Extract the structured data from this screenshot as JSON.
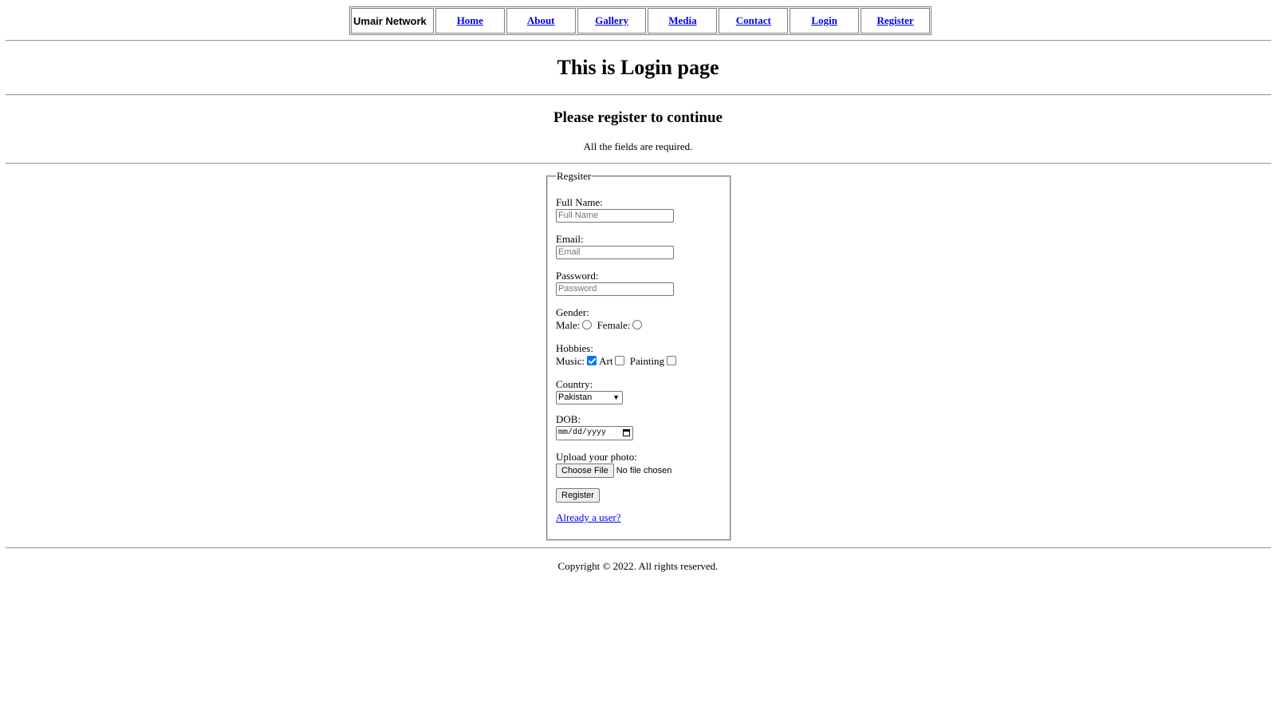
{
  "nav": {
    "brand": "Umair Network",
    "links": [
      "Home",
      "About",
      "Gallery",
      "Media",
      "Contact",
      "Login",
      "Register"
    ]
  },
  "page": {
    "title": "This is Login page",
    "subtitle": "Please register to continue",
    "note": "All the fields are required."
  },
  "form": {
    "legend": "Regsiter",
    "full_name_label": "Full Name:",
    "full_name_placeholder": "Full Name",
    "email_label": "Email:",
    "email_placeholder": "Email",
    "password_label": "Password:",
    "password_placeholder": "Password",
    "gender_label": "Gender:",
    "gender_options": [
      "Male:",
      "Female:"
    ],
    "hobbies_label": "Hobbies:",
    "hobbies": [
      {
        "label": "Music:",
        "checked": true
      },
      {
        "label": "Art",
        "checked": false
      },
      {
        "label": "Painting",
        "checked": false
      }
    ],
    "country_label": "Country:",
    "country_value": "Pakistan",
    "dob_label": "DOB:",
    "dob_placeholder": "mm/dd/yyyy",
    "photo_label": "Upload your photo:",
    "choose_file_label": "Choose File",
    "file_status": "No file chosen",
    "submit_label": "Register",
    "already_user_link": "Already a user?"
  },
  "footer": {
    "copyright": "Copyright © 2022. All rights reserved."
  }
}
